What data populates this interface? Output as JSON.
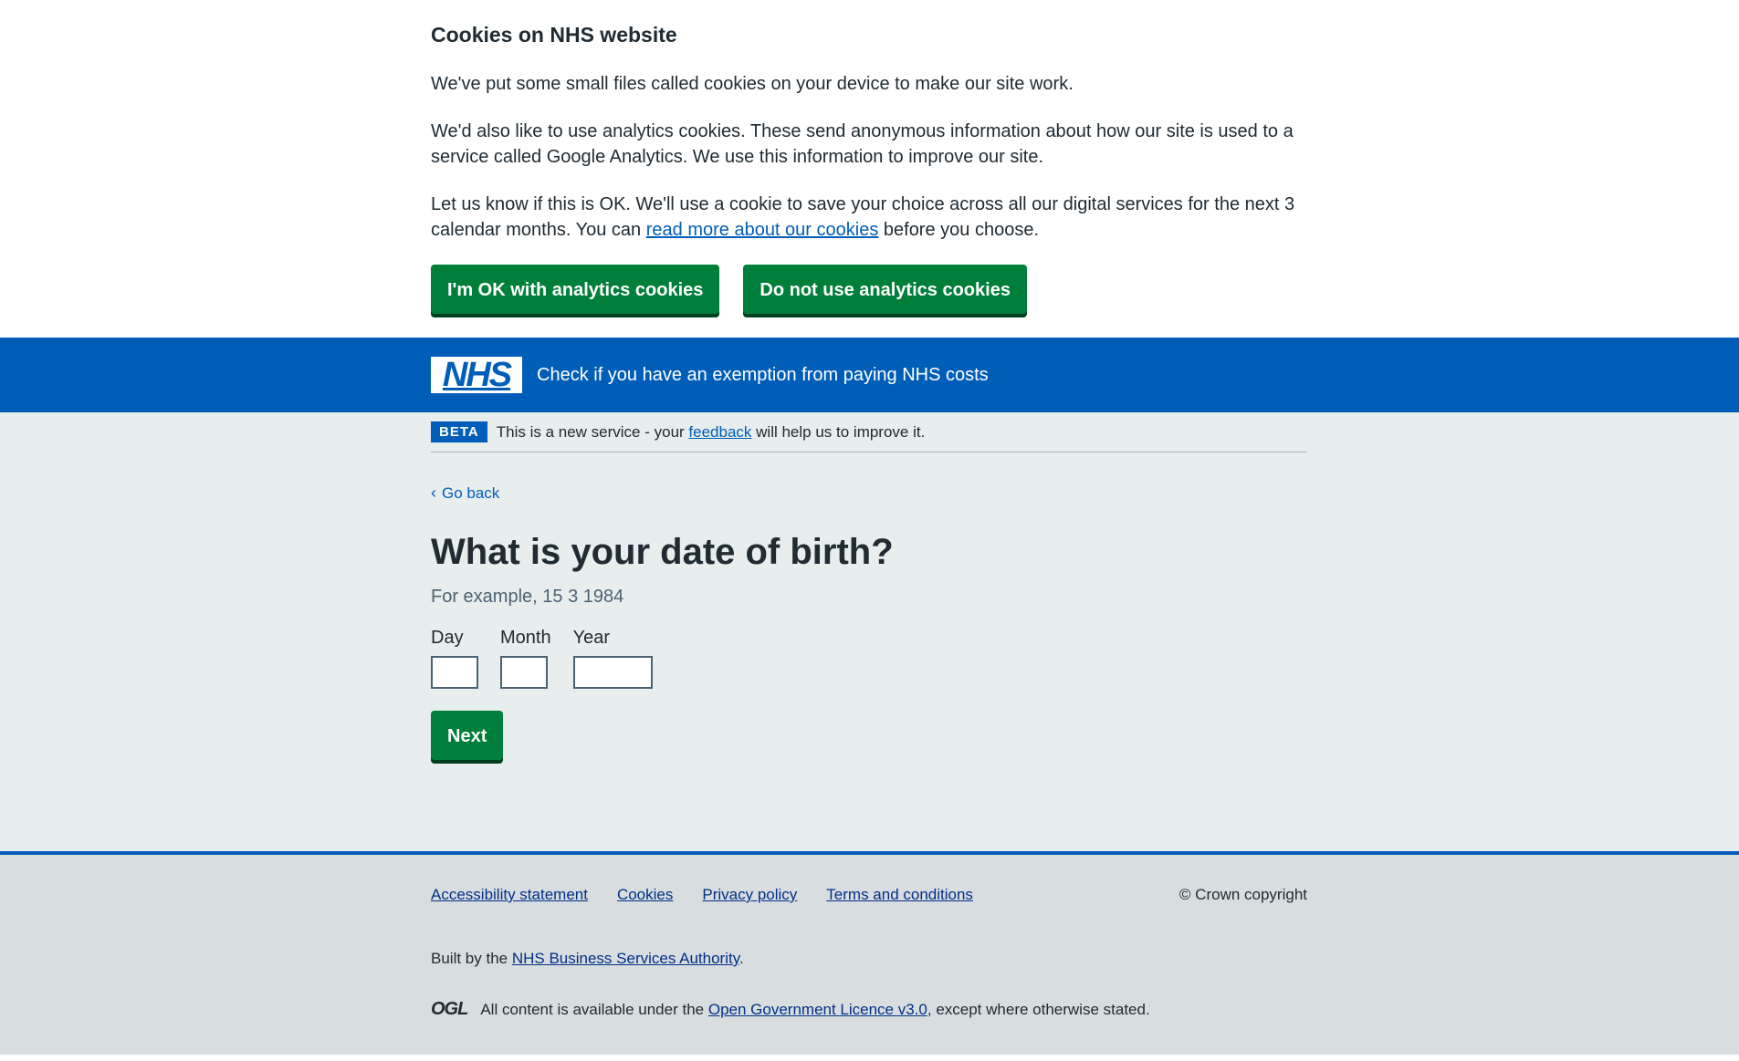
{
  "cookie_banner": {
    "title": "Cookies on NHS website",
    "para1": "We've put some small files called cookies on your device to make our site work.",
    "para2": "We'd also like to use analytics cookies. These send anonymous information about how our site is used to a service called Google Analytics. We use this information to improve our site.",
    "para3_before": "Let us know if this is OK. We'll use a cookie to save your choice across all our digital services for the next 3 calendar months. You can ",
    "para3_link": "read more about our cookies",
    "para3_after": " before you choose.",
    "accept_label": "I'm OK with analytics cookies",
    "reject_label": "Do not use analytics cookies"
  },
  "header": {
    "logo_text": "NHS",
    "service_name": "Check if you have an exemption from paying NHS costs"
  },
  "phase_banner": {
    "tag": "BETA",
    "text_before": "This is a new service - your ",
    "link": "feedback",
    "text_after": " will help us to improve it."
  },
  "back_link": "Go back",
  "question": {
    "title": "What is your date of birth?",
    "hint": "For example, 15 3 1984",
    "day_label": "Day",
    "month_label": "Month",
    "year_label": "Year",
    "day_value": "",
    "month_value": "",
    "year_value": ""
  },
  "next_label": "Next",
  "footer": {
    "links": [
      "Accessibility statement",
      "Cookies",
      "Privacy policy",
      "Terms and conditions"
    ],
    "copyright": "© Crown copyright",
    "built_before": "Built by the ",
    "built_link": "NHS Business Services Authority",
    "built_after": ".",
    "ogl_logo": "OGL",
    "ogl_before": "All content is available under the ",
    "ogl_link": "Open Government Licence v3.0",
    "ogl_after": ", except where otherwise stated."
  },
  "colors": {
    "nhs_blue": "#005eb8",
    "button_green": "#007f3b",
    "page_grey": "#e8edee",
    "footer_grey": "#d8dde0"
  }
}
